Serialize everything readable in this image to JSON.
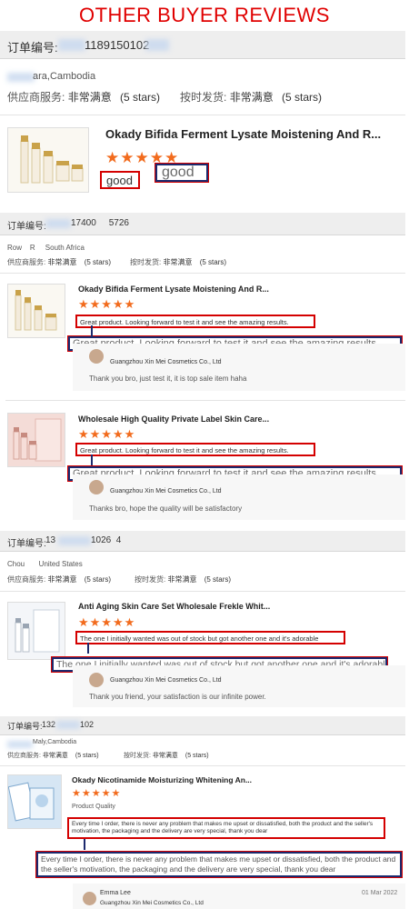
{
  "banner": "OTHER BUYER REVIEWS",
  "labels": {
    "order_no": "订单编号:",
    "supplier_service": "供应商服务:",
    "ontime_delivery": "按时发货:",
    "very_satisfied": "非常满意",
    "five_stars": "(5 stars)",
    "stars": "★★★★★",
    "supplier_name": "Guangzhou Xin Mei Cosmetics Co., Ltd"
  },
  "orders": [
    {
      "order_number": "1189150102",
      "location": "ara,Cambodia",
      "product": "Okady Bifida Ferment Lysate Moistening And R...",
      "review": "good",
      "review_enlarged": "good"
    },
    {
      "order_number": "17400     5726",
      "location": "Row    R     South Africa",
      "items": [
        {
          "product": "Okady Bifida Ferment Lysate Moistening And R...",
          "review": "Great product. Looking forward to test it and see the amazing results.",
          "review_enlarged": "Great product. Looking forward to test it and see the amazing results.",
          "reply": "Thank you bro,  just test it, it is top sale item haha"
        },
        {
          "product": "Wholesale High Quality Private Label Skin Care...",
          "review": "Great product. Looking forward to test it and see the amazing results.",
          "review_enlarged": "Great product. Looking forward to test it and see the amazing results.",
          "reply": "Thanks bro,  hope the quality will be satisfactory"
        }
      ]
    },
    {
      "order_number_prefix": "13",
      "order_number": "1026  4",
      "location": "Chou       United States",
      "product": "Anti Aging Skin Care Set Wholesale Frekle Whit...",
      "review": "The one I initially wanted was out of stock but got another one and it's adorable",
      "review_enlarged": "The one I initially wanted was out of stock but got another one and it's adorable.",
      "reply": "Thank you friend, your satisfaction is our infinite power."
    },
    {
      "order_number_prefix": "132",
      "order_number": "102",
      "location": "Maly,Cambodia",
      "product": "Okady Nicotinamide Moisturizing Whitening An...",
      "quality_label": "Product Quality",
      "review": "Every time I order, there is never any problem that makes me upset or dissatisfied, both the product and the seller's motivation, the packaging and the delivery are very special, thank you dear",
      "review_enlarged": "Every time I order, there is never any problem that makes me upset or dissatisfied, both the product and the seller's motivation, the packaging and the delivery are very special, thank you dear",
      "reply_author": "Emma Lee",
      "reply_date": "01 Mar 2022"
    }
  ]
}
